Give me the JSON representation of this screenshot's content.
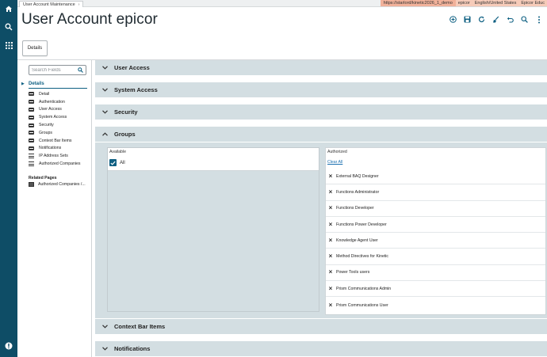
{
  "app_tab": {
    "label": "User Account Maintenance"
  },
  "environment": {
    "url": "https://starlord/kinetic2026_1_demo",
    "company": "epicor",
    "locale": "English/United States",
    "edition": "Epicor Educ"
  },
  "page": {
    "title": "User Account epicor"
  },
  "toolbar": {
    "icons": [
      "add-icon",
      "save-icon",
      "refresh-icon",
      "clear-icon",
      "undo-icon",
      "search-icon",
      "overflow-menu-icon"
    ]
  },
  "details_button": {
    "label": "Details"
  },
  "sidenav": {
    "search_placeholder": "Search Fields",
    "section_title": "Details",
    "items": [
      {
        "label": "Detail",
        "icon": "card-icon"
      },
      {
        "label": "Authentication",
        "icon": "card-icon"
      },
      {
        "label": "User Access",
        "icon": "card-icon"
      },
      {
        "label": "System Access",
        "icon": "card-icon"
      },
      {
        "label": "Security",
        "icon": "card-icon"
      },
      {
        "label": "Groups",
        "icon": "card-icon"
      },
      {
        "label": "Context Bar Items",
        "icon": "card-icon"
      },
      {
        "label": "Notifications",
        "icon": "card-icon"
      },
      {
        "label": "IP Address Sets",
        "icon": "list-icon"
      },
      {
        "label": "Authorized Companies",
        "icon": "list-icon"
      }
    ],
    "related_title": "Related Pages",
    "related_items": [
      {
        "label": "Authorized Companies /...",
        "icon": "pages-icon"
      }
    ]
  },
  "sections": {
    "user_access": "User Access",
    "system_access": "System Access",
    "security": "Security",
    "groups": "Groups",
    "context_bar_items": "Context Bar Items",
    "notifications": "Notifications"
  },
  "groups": {
    "available_label": "Available",
    "all_label": "All",
    "all_checked": true,
    "authorized_label": "Authorized",
    "clear_all_label": "Clear All",
    "authorized_items": [
      "External BAQ Designer",
      "Functions Administrator",
      "Functions Developer",
      "Functions Power Developer",
      "Knowledge Agent User",
      "Method Directives for Kinetic",
      "Power Tools users",
      "Prism Communications Admin",
      "Prism Communications User"
    ]
  },
  "colors": {
    "rail": "#0e4d66",
    "accent": "#0d5f82",
    "section_bg": "#d3dee2",
    "env_url_bg": "#f1b19a"
  }
}
